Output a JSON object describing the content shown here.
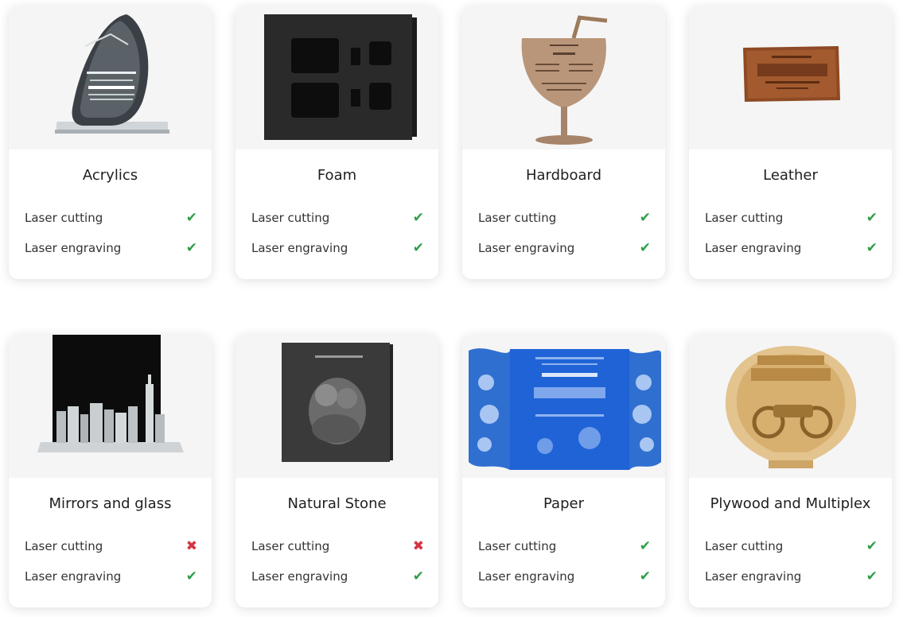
{
  "materials": [
    {
      "name": "Acrylics",
      "features": [
        {
          "label": "Laser cutting",
          "status": "check-icon"
        },
        {
          "label": "Laser engraving",
          "status": "check-icon"
        }
      ],
      "image_text": [
        "20 YEARS OF SERVICE",
        "DENNIS S. GREEN"
      ]
    },
    {
      "name": "Foam",
      "features": [
        {
          "label": "Laser cutting",
          "status": "check-icon"
        },
        {
          "label": "Laser engraving",
          "status": "check-icon"
        }
      ]
    },
    {
      "name": "Hardboard",
      "features": [
        {
          "label": "Laser cutting",
          "status": "check-icon"
        },
        {
          "label": "Laser engraving",
          "status": "check-icon"
        }
      ],
      "image_text": [
        "Cocktail",
        "MENU"
      ]
    },
    {
      "name": "Leather",
      "features": [
        {
          "label": "Laser cutting",
          "status": "check-icon"
        },
        {
          "label": "Laser engraving",
          "status": "check-icon"
        }
      ],
      "image_text": [
        "Authentic",
        "JEANSOME",
        "Original Denim Jeans"
      ]
    },
    {
      "name": "Mirrors and glass",
      "features": [
        {
          "label": "Laser cutting",
          "status": "cross-icon"
        },
        {
          "label": "Laser engraving",
          "status": "check-icon"
        }
      ]
    },
    {
      "name": "Natural Stone",
      "features": [
        {
          "label": "Laser cutting",
          "status": "cross-icon"
        },
        {
          "label": "Laser engraving",
          "status": "check-icon"
        }
      ],
      "image_text": [
        "Nathan & Audrey"
      ]
    },
    {
      "name": "Paper",
      "features": [
        {
          "label": "Laser cutting",
          "status": "check-icon"
        },
        {
          "label": "Laser engraving",
          "status": "check-icon"
        }
      ],
      "image_text": [
        "CLAIRE & STEVEN",
        "Save the date"
      ]
    },
    {
      "name": "Plywood and Multiplex",
      "features": [
        {
          "label": "Laser cutting",
          "status": "check-icon"
        },
        {
          "label": "Laser engraving",
          "status": "check-icon"
        }
      ],
      "image_text": [
        "CUSTOM",
        "MOTORCYCLES"
      ]
    }
  ],
  "icons": {
    "check-icon": "✔",
    "cross-icon": "✖"
  },
  "colors": {
    "check": "#2e9e48",
    "cross": "#d63342",
    "image_bg": "#f5f5f5"
  }
}
